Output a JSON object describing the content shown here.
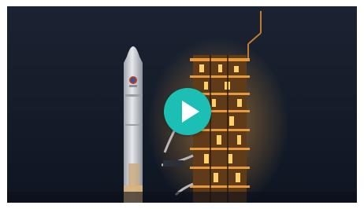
{
  "video": {
    "thumbnail_subject": "rocket-on-launch-pad-at-night",
    "play_icon": "play-icon",
    "accent_color": "#1bbfb4"
  }
}
